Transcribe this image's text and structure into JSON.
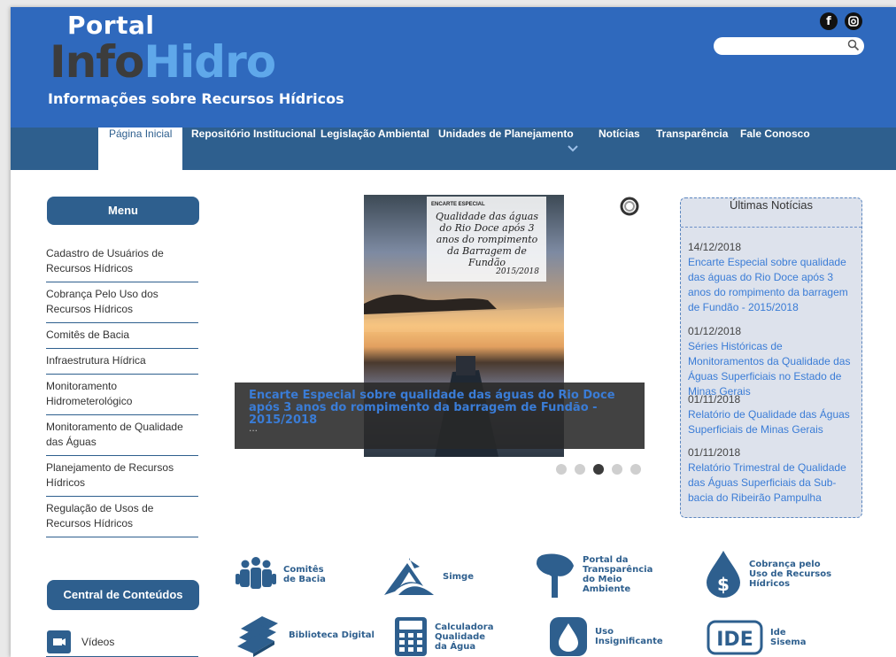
{
  "header": {
    "logo_top": "Portal",
    "logo_part1": "Info",
    "logo_part2": "Hidro",
    "logo_sub": "Informações sobre Recursos Hídricos",
    "social": [
      {
        "name": "facebook-icon",
        "glyph": "f"
      },
      {
        "name": "instagram-icon",
        "glyph": "◙"
      }
    ],
    "search_placeholder": ""
  },
  "nav": {
    "items": [
      "Página Inicial",
      "Repositório Institucional",
      "Legislação Ambiental",
      "Unidades de Planejamento",
      "Notícias",
      "Transparência",
      "Fale Conosco"
    ],
    "active": "Página Inicial"
  },
  "sidebar": {
    "menu_title": "Menu",
    "items": [
      "Cadastro de Usuários de Recursos Hídricos",
      "Cobrança Pelo Uso dos Recursos Hídricos",
      "Comitês de Bacia",
      "Infraestrutura Hídrica",
      "Monitoramento Hidrometerológico",
      "Monitoramento de Qualidade das Águas",
      "Planejamento de Recursos Hídricos",
      "Regulação de Usos de Recursos Hídricos"
    ],
    "central_title": "Central de Conteúdos",
    "videos_label": "Vídeos"
  },
  "carousel": {
    "card_tag": "ENCARTE ESPECIAL",
    "card_script": "Qualidade das águas do Rio Doce após 3 anos do rompimento da Barragem de Fundão",
    "card_year": "2015/2018",
    "caption_title": "Encarte Especial sobre qualidade das águas do Rio Doce após 3 anos do rompimento da barragem de Fundão - 2015/2018",
    "caption_desc": "...",
    "dots": 5,
    "active_dot": 3
  },
  "news": {
    "title": "Últimas Notícias",
    "items": [
      {
        "date": "14/12/2018",
        "text": "Encarte Especial sobre qualidade das águas do Rio Doce após 3 anos do rompimento da barragem de Fundão - 2015/2018"
      },
      {
        "date": "01/12/2018",
        "text": "Séries Históricas de Monitoramentos da Qualidade das Águas Superficiais no Estado de Minas Gerais"
      },
      {
        "date": "01/11/2018",
        "text": "Relatório de Qualidade das Águas Superficiais de Minas Gerais"
      },
      {
        "date": "01/11/2018",
        "text": "Relatório Trimestral de Qualidade das Águas Superficiais da Sub-bacia do Ribeirão Pampulha"
      }
    ]
  },
  "tiles": [
    {
      "label": "Comitês de Bacia",
      "icon": "people-group-icon"
    },
    {
      "label": "Simge",
      "icon": "simge-logo-icon"
    },
    {
      "label": "Portal da Transparência do Meio Ambiente",
      "icon": "tree-icon"
    },
    {
      "label": "Cobrança pelo Uso de Recursos Hídricos",
      "icon": "water-drop-dollar-icon"
    },
    {
      "label": "Biblioteca Digital",
      "icon": "books-icon"
    },
    {
      "label": "Calculadora Qualidade da Água",
      "icon": "calculator-icon"
    },
    {
      "label": "Uso Insignificante",
      "icon": "water-drop-icon"
    },
    {
      "label": "Ide Sisema",
      "icon": "ide-logo-icon"
    }
  ],
  "colors": {
    "header": "#2f69bd",
    "nav": "#2e5f8e",
    "link": "#3a7cd6"
  }
}
